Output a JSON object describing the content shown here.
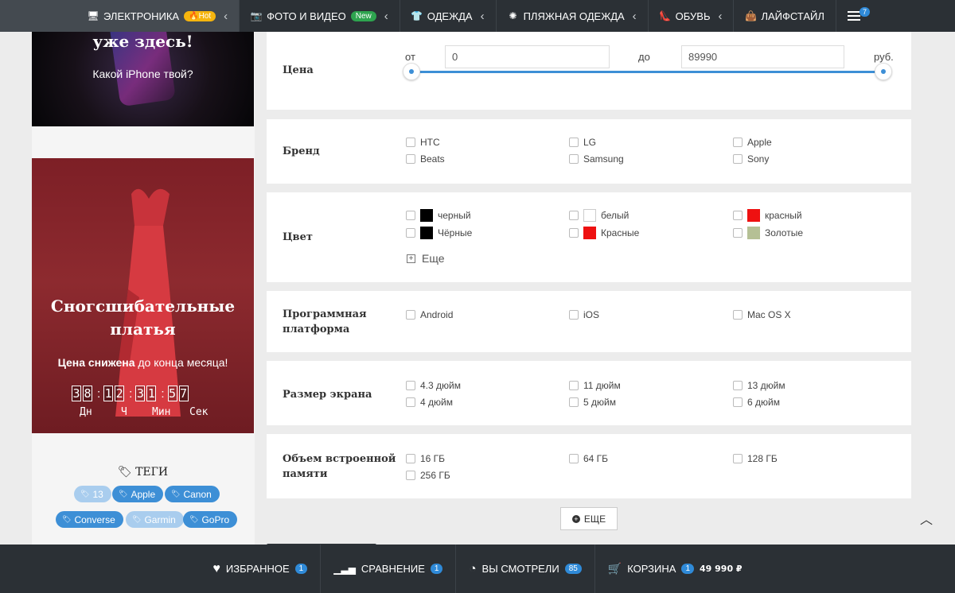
{
  "nav": {
    "items": [
      {
        "label": "ЭЛЕКТРОНИКА",
        "badge": "Hot",
        "icon": "monitor-icon"
      },
      {
        "label": "ФОТО И ВИДЕО",
        "badge": "New",
        "icon": "camera-icon"
      },
      {
        "label": "ОДЕЖДА",
        "icon": "tshirt-icon"
      },
      {
        "label": "ПЛЯЖНАЯ ОДЕЖДА",
        "icon": "sun-icon"
      },
      {
        "label": "ОБУВЬ",
        "icon": "heel-icon"
      },
      {
        "label": "ЛАЙФСТАЙЛ",
        "icon": "bag-icon"
      }
    ],
    "menu_count": "7"
  },
  "sidebar": {
    "iphone_banner": {
      "title": "уже здесь!",
      "subtitle": "Какой iPhone твой?"
    },
    "dress_banner": {
      "title_line1": "Сногсшибательные",
      "title_line2": "платья",
      "sub_bold": "Цена снижена",
      "sub_rest": " до конца месяца!",
      "digits": [
        "3",
        "8",
        "1",
        "2",
        "3",
        "1",
        "5",
        "7"
      ],
      "labels": [
        "Дн",
        "Ч",
        "Мин",
        "Сек"
      ]
    },
    "tags_title": "ТЕГИ",
    "tags": [
      "13",
      "Apple",
      "Canon",
      "Converse",
      "Garmin",
      "GoPro"
    ]
  },
  "filters": {
    "price": {
      "label": "Цена",
      "from_label": "от",
      "from_value": "0",
      "to_label": "до",
      "to_value": "89990",
      "currency": "руб."
    },
    "brand": {
      "label": "Бренд",
      "options": [
        "HTC",
        "LG",
        "Apple",
        "Beats",
        "Samsung",
        "Sony"
      ]
    },
    "color": {
      "label": "Цвет",
      "options": [
        {
          "name": "черный",
          "color": "#000000"
        },
        {
          "name": "белый",
          "color": "#ffffff"
        },
        {
          "name": "красный",
          "color": "#ee1111"
        },
        {
          "name": "Чёрные",
          "color": "#000000"
        },
        {
          "name": "Красные",
          "color": "#ee1111"
        },
        {
          "name": "Золотые",
          "color": "#b5c095"
        }
      ],
      "more": "Еще"
    },
    "platform": {
      "label_line1": "Программная",
      "label_line2": "платформа",
      "options": [
        "Android",
        "iOS",
        "Mac OS X"
      ]
    },
    "screen": {
      "label": "Размер экрана",
      "options": [
        "4.3 дюйм",
        "11 дюйм",
        "13 дюйм",
        "4 дюйм",
        "5 дюйм",
        "6 дюйм"
      ]
    },
    "memory": {
      "label_line1": "Объем встроенной",
      "label_line2": "памяти",
      "options": [
        "16 ГБ",
        "64 ГБ",
        "128 ГБ",
        "256 ГБ"
      ]
    }
  },
  "more_button": "ЕЩЕ",
  "bottom": {
    "favorites": {
      "label": "ИЗБРАННОЕ",
      "count": "1"
    },
    "compare": {
      "label": "СРАВНЕНИЕ",
      "count": "1"
    },
    "viewed": {
      "label": "ВЫ СМОТРЕЛИ",
      "count": "85"
    },
    "cart": {
      "label": "КОРЗИНА",
      "count": "1",
      "total": "49 990 ₽"
    }
  }
}
